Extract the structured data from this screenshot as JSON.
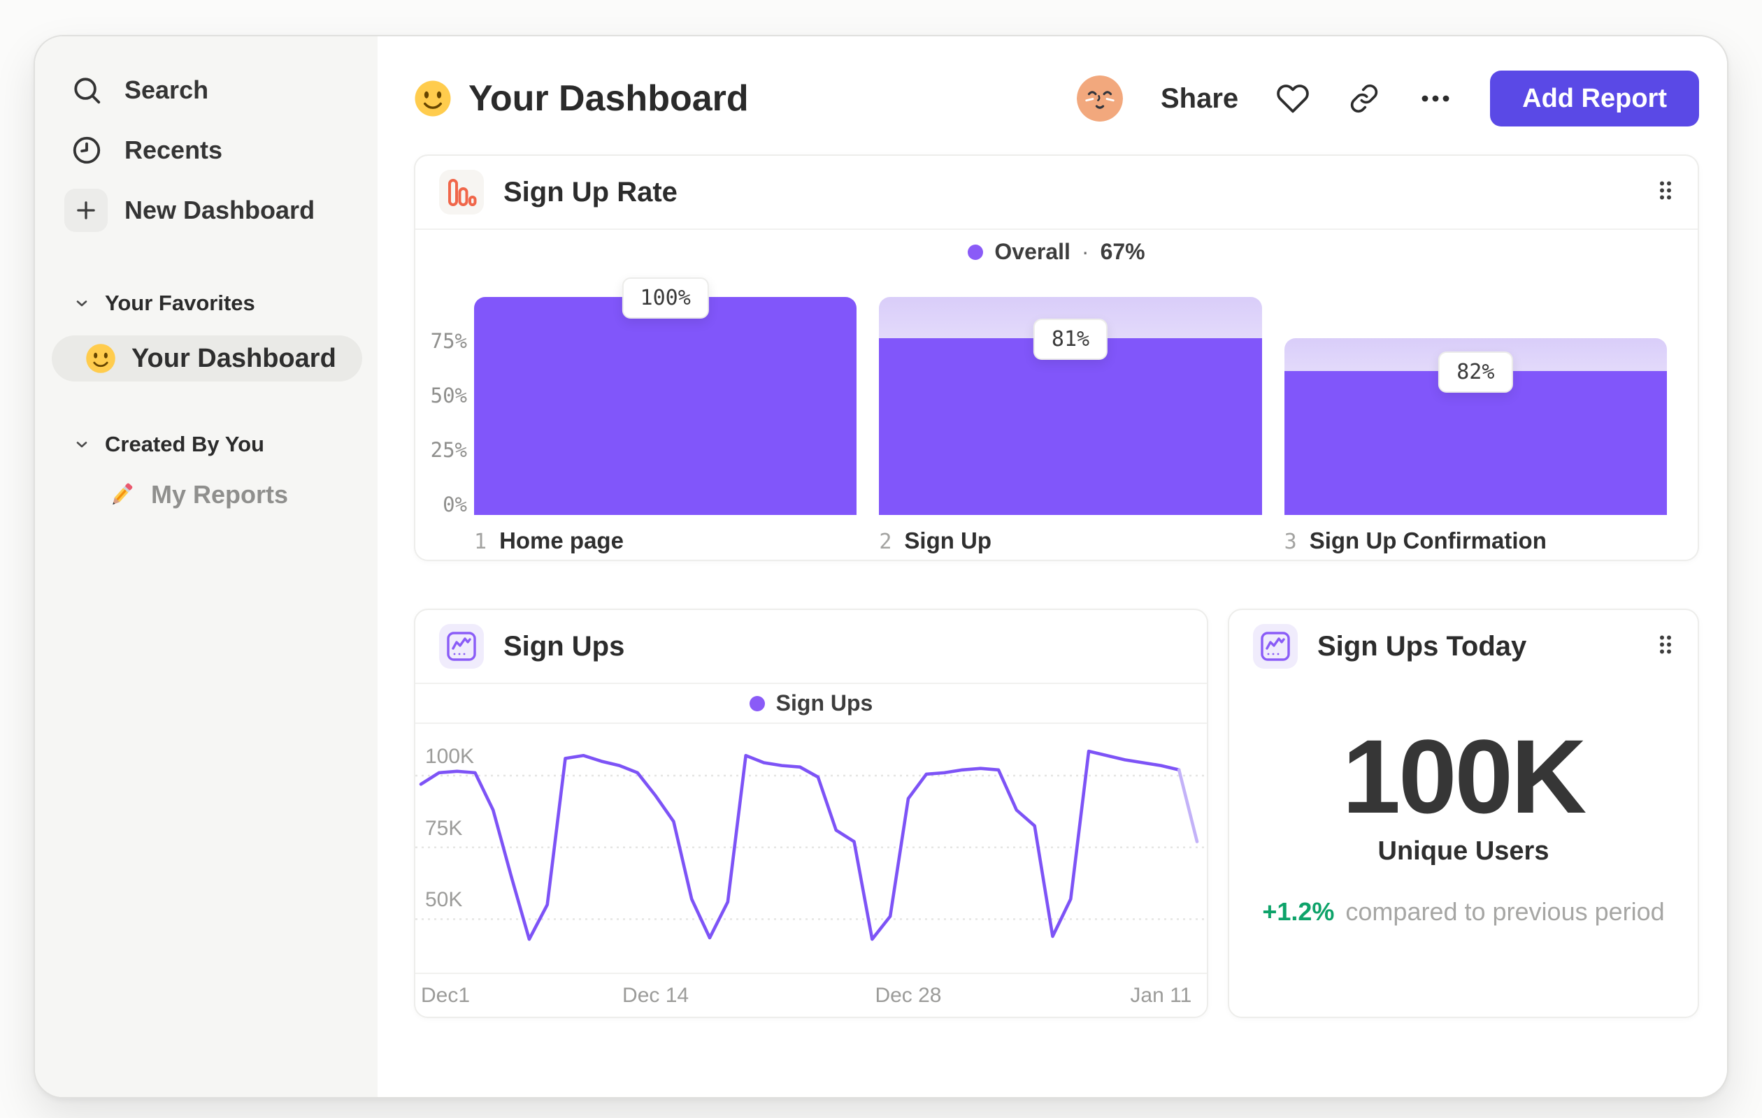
{
  "header": {
    "title": "Your Dashboard",
    "share_label": "Share",
    "add_report_label": "Add Report"
  },
  "sidebar": {
    "nav": [
      {
        "label": "Search",
        "icon": "search-icon"
      },
      {
        "label": "Recents",
        "icon": "clock-icon"
      },
      {
        "label": "New Dashboard",
        "icon": "plus-icon"
      }
    ],
    "sections": [
      {
        "label": "Your Favorites",
        "items": [
          {
            "label": "Your Dashboard",
            "icon": "smiley-emoji",
            "selected": true
          }
        ]
      },
      {
        "label": "Created By You",
        "items": [
          {
            "label": "My Reports",
            "icon": "pencil-emoji",
            "selected": false
          }
        ]
      }
    ]
  },
  "cards": {
    "funnel": {
      "title": "Sign Up Rate",
      "icon": "bar-chart-icon",
      "legend_label": "Overall",
      "legend_sep": "·",
      "legend_value": "67%"
    },
    "line": {
      "title": "Sign Ups",
      "icon": "line-chart-icon",
      "legend_label": "Sign Ups"
    },
    "metric": {
      "title": "Sign Ups Today",
      "icon": "line-chart-icon",
      "value": "100K",
      "label": "Unique Users",
      "delta": "+1.2%",
      "delta_note": "compared to previous period"
    }
  },
  "chart_data": [
    {
      "type": "bar",
      "title": "Sign Up Rate",
      "categories": [
        "Home page",
        "Sign Up",
        "Sign Up Confirmation"
      ],
      "step_indices": [
        "1",
        "2",
        "3"
      ],
      "step_conversion_labels": [
        "100%",
        "81%",
        "82%"
      ],
      "overall_pct": [
        100,
        81,
        66
      ],
      "prev_overall_pct": [
        100,
        100,
        81
      ],
      "legend": "Overall · 67%",
      "yticks": [
        "0%",
        "25%",
        "50%",
        "75%"
      ],
      "ylim": [
        0,
        110
      ],
      "bar_color": "#8156FA"
    },
    {
      "type": "line",
      "title": "Sign Ups",
      "series": [
        {
          "name": "Sign Ups",
          "values_thousands": [
            97,
            101,
            101.5,
            101,
            88,
            65,
            43,
            55,
            106,
            107,
            105,
            103.5,
            101,
            93,
            84,
            57,
            43.5,
            56,
            107,
            104.5,
            103.5,
            103,
            99.5,
            81,
            77,
            43,
            51,
            92,
            100.5,
            101,
            102,
            102.5,
            102,
            88,
            82.5,
            44,
            57,
            108.5,
            107,
            105.5,
            104.5,
            103.5,
            102,
            77
          ]
        }
      ],
      "x_tick_labels": [
        "Dec1",
        "Dec 14",
        "Dec 28",
        "Jan 11"
      ],
      "x_tick_indices": [
        0,
        13,
        27,
        41
      ],
      "yticks_thousands": [
        100,
        75,
        50
      ],
      "ytick_labels": [
        "100K",
        "75K",
        "50K"
      ],
      "ylim_thousands": [
        38,
        118
      ],
      "grid": "dashed-horizontal",
      "legend_position": "top-center",
      "line_color": "#7d53f6",
      "faded_tail_color": "#c3b2f8",
      "last_segment_faded": true
    },
    {
      "type": "metric",
      "title": "Sign Ups Today",
      "value": "100K",
      "unit_label": "Unique Users",
      "delta_pct": "+1.2%",
      "comparison": "compared to previous period"
    }
  ],
  "colors": {
    "purple": "#8156FA",
    "legend_dot": "#8A5BF7",
    "button_indigo": "#5A49E6",
    "green": "#0EA36A",
    "orange_icon": "#F0664A",
    "sidebar_bg": "#F6F6F4",
    "pill_bg": "#EAEAE7"
  }
}
